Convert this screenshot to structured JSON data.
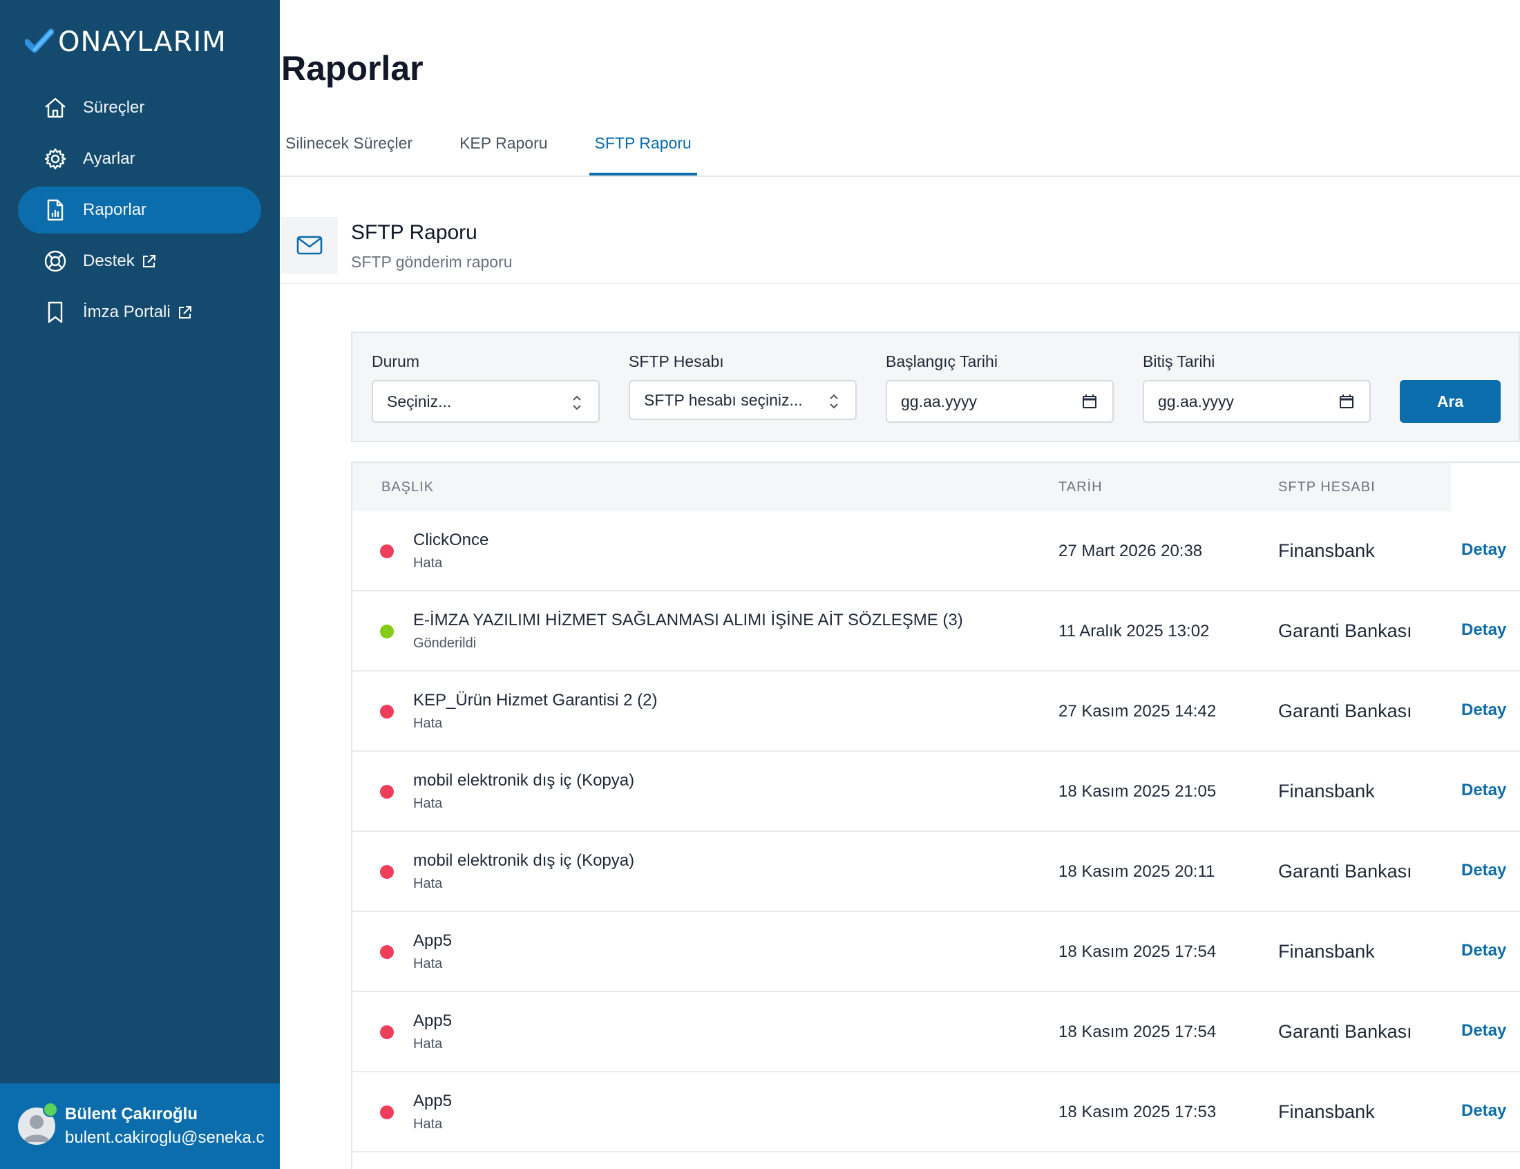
{
  "brand": {
    "name": "ONAYLARIM",
    "icon": "checkmark-logo"
  },
  "sidebar": {
    "items": [
      {
        "label": "Süreçler",
        "icon": "home-icon",
        "active": false,
        "external": false
      },
      {
        "label": "Ayarlar",
        "icon": "gear-icon",
        "active": false,
        "external": false
      },
      {
        "label": "Raporlar",
        "icon": "report-document-icon",
        "active": true,
        "external": false
      },
      {
        "label": "Destek",
        "icon": "lifebuoy-icon",
        "active": false,
        "external": true
      },
      {
        "label": "İmza Portali",
        "icon": "bookmark-icon",
        "active": false,
        "external": true
      }
    ],
    "user": {
      "name": "Bülent Çakıroğlu",
      "email": "bulent.cakiroglu@seneka.c",
      "status": "online"
    }
  },
  "page": {
    "title": "Raporlar"
  },
  "tabs": [
    {
      "label": "Silinecek Süreçler",
      "active": false
    },
    {
      "label": "KEP Raporu",
      "active": false
    },
    {
      "label": "SFTP Raporu",
      "active": true
    }
  ],
  "section": {
    "title": "SFTP Raporu",
    "subtitle": "SFTP gönderim raporu",
    "icon": "mail-icon"
  },
  "filters": {
    "status": {
      "label": "Durum",
      "value": "Seçiniz..."
    },
    "account": {
      "label": "SFTP Hesabı",
      "value": "SFTP hesabı seçiniz..."
    },
    "start_date": {
      "label": "Başlangıç Tarihi",
      "value": "gg.aa.yyyy"
    },
    "end_date": {
      "label": "Bitiş Tarihi",
      "value": "gg.aa.yyyy"
    },
    "search_label": "Ara"
  },
  "table": {
    "headers": {
      "title": "BAŞLIK",
      "date": "TARİH",
      "account": "SFTP HESABI"
    },
    "detail_label": "Detay",
    "rows": [
      {
        "title": "ClickOnce",
        "status": "Hata",
        "date": "27 Mart 2026 20:38",
        "account": "Finansbank",
        "status_color": "#ef3e5c"
      },
      {
        "title": "E-İMZA YAZILIMI HİZMET SAĞLANMASI ALIMI İŞİNE AİT SÖZLEŞME (3)",
        "status": "Gönderildi",
        "date": "11 Aralık 2025 13:02",
        "account": "Garanti Bankası",
        "status_color": "#84cc16"
      },
      {
        "title": "KEP_Ürün Hizmet Garantisi 2 (2)",
        "status": "Hata",
        "date": "27 Kasım 2025 14:42",
        "account": "Garanti Bankası",
        "status_color": "#ef3e5c"
      },
      {
        "title": "mobil elektronik dış iç (Kopya)",
        "status": "Hata",
        "date": "18 Kasım 2025 21:05",
        "account": "Finansbank",
        "status_color": "#ef3e5c"
      },
      {
        "title": "mobil elektronik dış iç (Kopya)",
        "status": "Hata",
        "date": "18 Kasım 2025 20:11",
        "account": "Garanti Bankası",
        "status_color": "#ef3e5c"
      },
      {
        "title": "App5",
        "status": "Hata",
        "date": "18 Kasım 2025 17:54",
        "account": "Finansbank",
        "status_color": "#ef3e5c"
      },
      {
        "title": "App5",
        "status": "Hata",
        "date": "18 Kasım 2025 17:54",
        "account": "Garanti Bankası",
        "status_color": "#ef3e5c"
      },
      {
        "title": "App5",
        "status": "Hata",
        "date": "18 Kasım 2025 17:53",
        "account": "Finansbank",
        "status_color": "#ef3e5c"
      }
    ]
  },
  "colors": {
    "sidebar_bg": "#134a6e",
    "accent": "#0b6dab",
    "error": "#ef3e5c",
    "success": "#84cc16"
  }
}
